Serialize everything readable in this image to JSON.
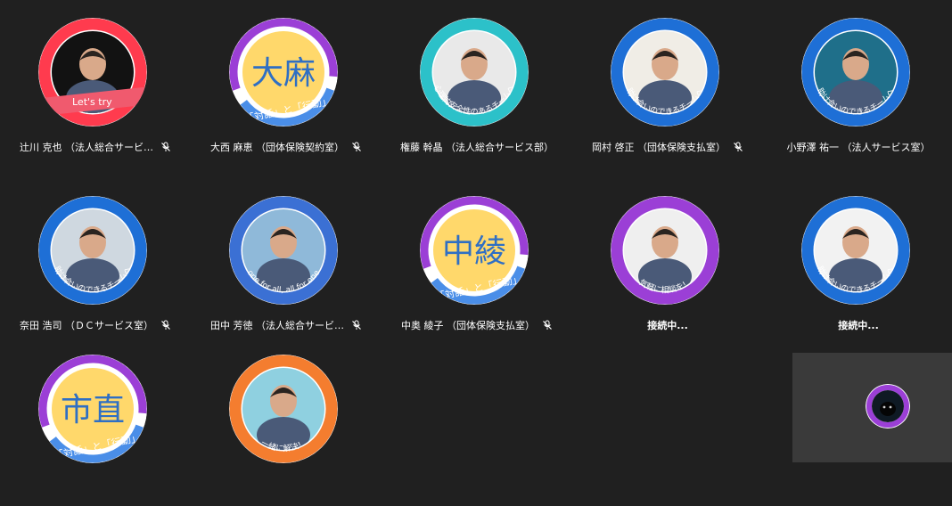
{
  "participants": [
    {
      "name": "辻川 克也 （法人総合サービ…",
      "muted": true,
      "avatar": {
        "type": "photo-ring",
        "ring": "#ff3b4e",
        "inner": "#121212",
        "banner_text": "Let's try",
        "banner_color": "#f05a6e"
      }
    },
    {
      "name": "大西 麻恵 （団体保険契約室）",
      "muted": true,
      "avatar": {
        "type": "kanji",
        "kanji": "大麻",
        "caption": "「対話」と「行動」",
        "ring": "#9b3fd6",
        "accent": "#4a8ee8",
        "fill": "#ffd86b"
      }
    },
    {
      "name": "権藤 幹晶 （法人総合サービス部）",
      "muted": false,
      "avatar": {
        "type": "photo-ring",
        "ring": "#2cc1c9",
        "inner": "#e9e9e9",
        "arc_text": "心理的安全性のあるチームへ"
      }
    },
    {
      "name": "岡村 啓正 （団体保険支払室）",
      "muted": true,
      "avatar": {
        "type": "photo-ring",
        "ring": "#1e6fd6",
        "inner": "#f0ede6",
        "arc_text": "助け合いのできるチームへ"
      }
    },
    {
      "name": "小野澤 祐一 （法人サービス室）",
      "muted": false,
      "avatar": {
        "type": "photo-ring",
        "ring": "#1e6fd6",
        "inner": "#1f6f8a",
        "arc_text": "助け合いのできるチームへ"
      }
    },
    {
      "name": "奈田 浩司 （ＤＣサービス室）",
      "muted": true,
      "avatar": {
        "type": "photo-ring",
        "ring": "#1e6fd6",
        "inner": "#cfd8e0",
        "arc_text": "助け合いのできるチームへ"
      }
    },
    {
      "name": "田中 芳徳 （法人総合サービ…",
      "muted": true,
      "avatar": {
        "type": "photo-ring",
        "ring": "#3b70d4",
        "inner": "#8fb9d9",
        "arc_text": "one for all, all for one"
      }
    },
    {
      "name": "中奥 綾子 （団体保険支払室）",
      "muted": true,
      "avatar": {
        "type": "kanji",
        "kanji": "中綾",
        "caption": "「対話」と「行動」",
        "ring": "#9b3fd6",
        "accent": "#4a8ee8",
        "fill": "#ffd86b"
      }
    },
    {
      "name": "接続中...",
      "status": true,
      "muted": false,
      "avatar": {
        "type": "photo-ring",
        "ring": "#9b3fd6",
        "inner": "#efefef",
        "arc_text": "気軽に相談を！"
      }
    },
    {
      "name": "接続中...",
      "status": true,
      "muted": false,
      "avatar": {
        "type": "photo-ring",
        "ring": "#1e6fd6",
        "inner": "#f2f2f2",
        "arc_text": "助け合いのできるチームへ"
      }
    },
    {
      "name": "",
      "muted": false,
      "avatar": {
        "type": "kanji",
        "kanji": "市直",
        "caption": "「対話」と「行動」",
        "ring": "#9b3fd6",
        "accent": "#4a8ee8",
        "fill": "#ffd86b"
      }
    },
    {
      "name": "",
      "muted": false,
      "avatar": {
        "type": "photo-ring",
        "ring": "#f47d2f",
        "inner": "#8fd0e0",
        "arc_text": "一緒に解決！"
      }
    }
  ],
  "self_view": {
    "ring": "#9b3fd6",
    "inner": "#0f1a24"
  },
  "icons": {
    "mic_muted": "mic-muted-icon",
    "person": "person-silhouette-icon"
  }
}
